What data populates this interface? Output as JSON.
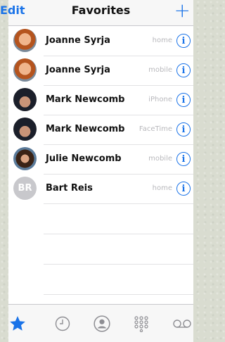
{
  "nav": {
    "left_label": "Edit",
    "title": "Favorites",
    "right_icon": "plus-icon",
    "accent": "#1a73e8"
  },
  "favorites": [
    {
      "name": "Joanne Syrja",
      "label": "home",
      "avatar": "photo"
    },
    {
      "name": "Joanne Syrja",
      "label": "mobile",
      "avatar": "photo"
    },
    {
      "name": "Mark Newcomb",
      "label": "iPhone",
      "avatar": "photo"
    },
    {
      "name": "Mark Newcomb",
      "label": "FaceTime",
      "avatar": "photo"
    },
    {
      "name": "Julie Newcomb",
      "label": "mobile",
      "avatar": "photo"
    },
    {
      "name": "Bart Reis",
      "label": "home",
      "avatar": "initials",
      "initials": "BR"
    }
  ],
  "tabbar": {
    "items": [
      {
        "icon": "star-icon",
        "active": true
      },
      {
        "icon": "clock-icon",
        "active": false
      },
      {
        "icon": "contact-icon",
        "active": false
      },
      {
        "icon": "keypad-icon",
        "active": false
      },
      {
        "icon": "voicemail-icon",
        "active": false
      }
    ]
  }
}
